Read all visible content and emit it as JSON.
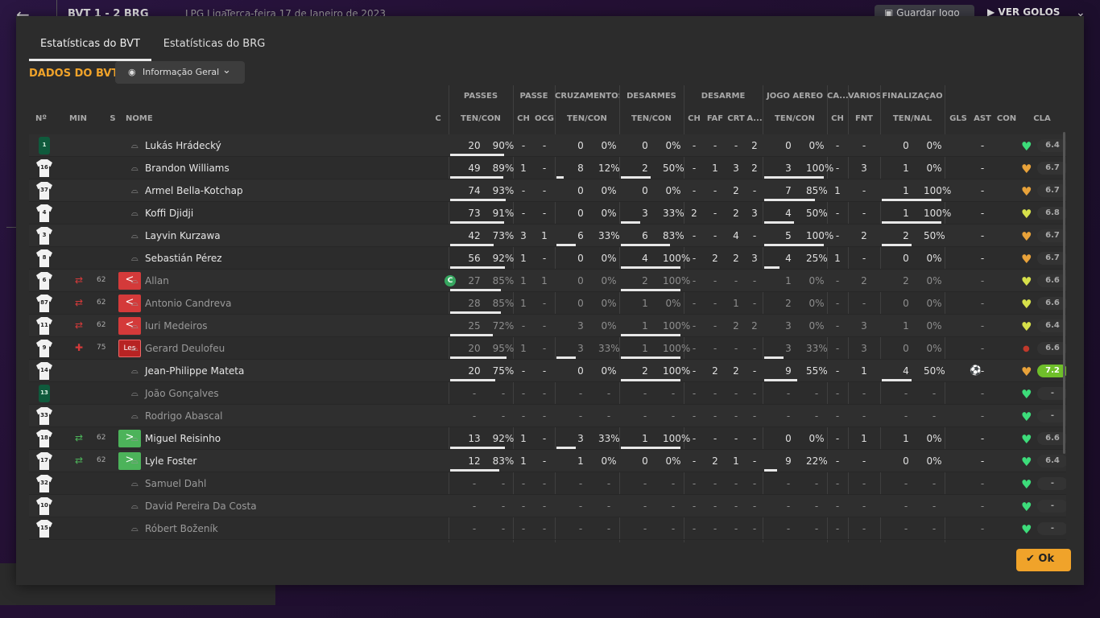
{
  "topbar": {
    "back": "←",
    "score": "BVT   1 - 2   BRG",
    "league": "LPG Liga",
    "date": "Terça-feira 17 de Janeiro de 2023",
    "save_label": "Guardar Jogo",
    "goals_label": "VER GOLOS"
  },
  "tabs": [
    "Estatísticas do BVT",
    "Estatísticas do BRG"
  ],
  "section_title": "DADOS DO BVT",
  "dropdown": "Informação Geral",
  "group_headers": [
    "PASSES",
    "PASSE",
    "CRUZAMENTOS",
    "DESARMES",
    "DESARME",
    "JOGO AÉREO",
    "CA...",
    "VÁRIOS",
    "FINALIZAÇÃO"
  ],
  "sub_headers": [
    "Nº",
    "MIN",
    "S",
    "NOME",
    "C",
    "TEN/CON",
    "CH",
    "OCG",
    "TEN/CON",
    "TEN/CON",
    "CH",
    "FAF",
    "CRT",
    "A...",
    "TEN/CON",
    "CH",
    "FNT",
    "TEN/NAL",
    "GLS",
    "AST",
    "CON",
    "CLA"
  ],
  "rows": [
    {
      "no": "1",
      "gk": true,
      "min": "",
      "sub": "",
      "s": "",
      "name": "Lukás Hrádecký",
      "cap": "",
      "dim": false,
      "pt": "20",
      "pp": "90%",
      "pch": "-",
      "pocg": "-",
      "cr": "0",
      "crp": "0%",
      "ds": "0",
      "dsp": "0%",
      "dch": "-",
      "faf": "-",
      "crt": "-",
      "da": "2",
      "ja": "0",
      "jap": "0%",
      "ca": "-",
      "fnt": "-",
      "fi": "0",
      "fip": "0%",
      "gls": "",
      "ast": "-",
      "con": "heart-green",
      "cla": "6.4",
      "best": false,
      "bars": {
        "p": 90,
        "c": 0,
        "d": 0,
        "j": 0,
        "f": 0
      }
    },
    {
      "no": "16",
      "gk": false,
      "min": "",
      "sub": "",
      "s": "",
      "name": "Brandon Williams",
      "cap": "",
      "dim": false,
      "pt": "49",
      "pp": "89%",
      "pch": "1",
      "pocg": "-",
      "cr": "8",
      "crp": "12%",
      "ds": "2",
      "dsp": "50%",
      "dch": "-",
      "faf": "1",
      "crt": "3",
      "da": "2",
      "ja": "3",
      "jap": "100%",
      "ca": "-",
      "fnt": "3",
      "fi": "1",
      "fip": "0%",
      "gls": "",
      "ast": "-",
      "con": "heart-orange",
      "cla": "6.7",
      "best": false,
      "bars": {
        "p": 89,
        "c": 12,
        "d": 50,
        "j": 100,
        "f": 0
      }
    },
    {
      "no": "37",
      "gk": false,
      "min": "",
      "sub": "",
      "s": "",
      "name": "Armel Bella-Kotchap",
      "cap": "",
      "dim": false,
      "pt": "74",
      "pp": "93%",
      "pch": "-",
      "pocg": "-",
      "cr": "0",
      "crp": "0%",
      "ds": "0",
      "dsp": "0%",
      "dch": "-",
      "faf": "-",
      "crt": "2",
      "da": "-",
      "ja": "7",
      "jap": "85%",
      "ca": "1",
      "fnt": "-",
      "fi": "1",
      "fip": "100%",
      "gls": "",
      "ast": "-",
      "con": "heart-orange",
      "cla": "6.7",
      "best": false,
      "bars": {
        "p": 93,
        "c": 0,
        "d": 0,
        "j": 85,
        "f": 100
      }
    },
    {
      "no": "4",
      "gk": false,
      "min": "",
      "sub": "",
      "s": "",
      "name": "Koffi Djidji",
      "cap": "",
      "dim": false,
      "pt": "73",
      "pp": "91%",
      "pch": "-",
      "pocg": "-",
      "cr": "0",
      "crp": "0%",
      "ds": "3",
      "dsp": "33%",
      "dch": "2",
      "faf": "-",
      "crt": "2",
      "da": "3",
      "ja": "4",
      "jap": "50%",
      "ca": "-",
      "fnt": "-",
      "fi": "1",
      "fip": "100%",
      "gls": "",
      "ast": "-",
      "con": "heart-yellow",
      "cla": "6.8",
      "best": false,
      "bars": {
        "p": 91,
        "c": 0,
        "d": 33,
        "j": 50,
        "f": 100
      }
    },
    {
      "no": "3",
      "gk": false,
      "min": "",
      "sub": "",
      "s": "",
      "name": "Layvin Kurzawa",
      "cap": "",
      "dim": false,
      "pt": "42",
      "pp": "73%",
      "pch": "3",
      "pocg": "1",
      "cr": "6",
      "crp": "33%",
      "ds": "6",
      "dsp": "83%",
      "dch": "-",
      "faf": "-",
      "crt": "4",
      "da": "-",
      "ja": "5",
      "jap": "100%",
      "ca": "-",
      "fnt": "2",
      "fi": "2",
      "fip": "50%",
      "gls": "",
      "ast": "-",
      "con": "heart-orange",
      "cla": "6.7",
      "best": false,
      "bars": {
        "p": 73,
        "c": 33,
        "d": 83,
        "j": 100,
        "f": 50
      }
    },
    {
      "no": "8",
      "gk": false,
      "min": "",
      "sub": "",
      "s": "",
      "name": "Sebastián Pérez",
      "cap": "",
      "dim": false,
      "pt": "56",
      "pp": "92%",
      "pch": "1",
      "pocg": "-",
      "cr": "0",
      "crp": "0%",
      "ds": "4",
      "dsp": "100%",
      "dch": "-",
      "faf": "2",
      "crt": "2",
      "da": "3",
      "ja": "4",
      "jap": "25%",
      "ca": "1",
      "fnt": "-",
      "fi": "0",
      "fip": "0%",
      "gls": "",
      "ast": "-",
      "con": "heart-orange",
      "cla": "6.7",
      "best": false,
      "bars": {
        "p": 92,
        "c": 0,
        "d": 100,
        "j": 25,
        "f": 0
      }
    },
    {
      "no": "6",
      "gk": false,
      "min": "62",
      "sub": "red",
      "s": "out",
      "name": "Allan",
      "cap": "C",
      "dim": true,
      "pt": "27",
      "pp": "85%",
      "pch": "1",
      "pocg": "1",
      "cr": "0",
      "crp": "0%",
      "ds": "2",
      "dsp": "100%",
      "dch": "-",
      "faf": "-",
      "crt": "-",
      "da": "-",
      "ja": "1",
      "jap": "0%",
      "ca": "-",
      "fnt": "2",
      "fi": "2",
      "fip": "0%",
      "gls": "",
      "ast": "-",
      "con": "heart-yellow",
      "cla": "6.6",
      "best": false,
      "bars": {
        "p": 85,
        "c": 0,
        "d": 100,
        "j": 0,
        "f": 0
      }
    },
    {
      "no": "87",
      "gk": false,
      "min": "62",
      "sub": "red",
      "s": "out",
      "name": "Antonio Candreva",
      "cap": "",
      "dim": true,
      "pt": "28",
      "pp": "85%",
      "pch": "1",
      "pocg": "-",
      "cr": "0",
      "crp": "0%",
      "ds": "1",
      "dsp": "0%",
      "dch": "-",
      "faf": "-",
      "crt": "1",
      "da": "-",
      "ja": "2",
      "jap": "0%",
      "ca": "-",
      "fnt": "-",
      "fi": "0",
      "fip": "0%",
      "gls": "",
      "ast": "-",
      "con": "heart-yellow",
      "cla": "6.6",
      "best": false,
      "bars": {
        "p": 85,
        "c": 0,
        "d": 0,
        "j": 0,
        "f": 0
      }
    },
    {
      "no": "11",
      "gk": false,
      "min": "62",
      "sub": "red",
      "s": "out",
      "name": "Iuri Medeiros",
      "cap": "",
      "dim": true,
      "pt": "25",
      "pp": "72%",
      "pch": "-",
      "pocg": "-",
      "cr": "3",
      "crp": "0%",
      "ds": "1",
      "dsp": "100%",
      "dch": "-",
      "faf": "-",
      "crt": "2",
      "da": "2",
      "ja": "3",
      "jap": "0%",
      "ca": "-",
      "fnt": "3",
      "fi": "1",
      "fip": "0%",
      "gls": "",
      "ast": "-",
      "con": "heart-yellow",
      "cla": "6.4",
      "best": false,
      "bars": {
        "p": 72,
        "c": 0,
        "d": 100,
        "j": 0,
        "f": 0
      }
    },
    {
      "no": "9",
      "gk": false,
      "min": "75",
      "sub": "injury",
      "s": "les",
      "name": "Gerard Deulofeu",
      "cap": "",
      "dim": true,
      "pt": "20",
      "pp": "95%",
      "pch": "1",
      "pocg": "-",
      "cr": "3",
      "crp": "33%",
      "ds": "1",
      "dsp": "100%",
      "dch": "-",
      "faf": "-",
      "crt": "-",
      "da": "-",
      "ja": "3",
      "jap": "33%",
      "ca": "-",
      "fnt": "3",
      "fi": "0",
      "fip": "0%",
      "gls": "",
      "ast": "-",
      "con": "dot-red",
      "cla": "6.6",
      "best": false,
      "bars": {
        "p": 95,
        "c": 33,
        "d": 100,
        "j": 33,
        "f": 0
      }
    },
    {
      "no": "14",
      "gk": false,
      "min": "",
      "sub": "",
      "s": "",
      "name": "Jean-Philippe Mateta",
      "cap": "",
      "dim": false,
      "pt": "20",
      "pp": "75%",
      "pch": "-",
      "pocg": "-",
      "cr": "0",
      "crp": "0%",
      "ds": "2",
      "dsp": "100%",
      "dch": "-",
      "faf": "2",
      "crt": "2",
      "da": "-",
      "ja": "9",
      "jap": "55%",
      "ca": "-",
      "fnt": "1",
      "fi": "4",
      "fip": "50%",
      "gls": "ball",
      "ast": "-",
      "con": "heart-orange",
      "cla": "7.2",
      "best": true,
      "bars": {
        "p": 75,
        "c": 0,
        "d": 100,
        "j": 55,
        "f": 50
      }
    },
    {
      "no": "13",
      "gk": true,
      "min": "",
      "sub": "",
      "s": "",
      "name": "João Gonçalves",
      "cap": "",
      "dim": true,
      "pt": "-",
      "pp": "-",
      "pch": "-",
      "pocg": "-",
      "cr": "-",
      "crp": "-",
      "ds": "-",
      "dsp": "-",
      "dch": "-",
      "faf": "-",
      "crt": "-",
      "da": "-",
      "ja": "-",
      "jap": "-",
      "ca": "-",
      "fnt": "-",
      "fi": "-",
      "fip": "-",
      "gls": "",
      "ast": "-",
      "con": "heart-green",
      "cla": "-",
      "best": false,
      "bars": {
        "p": 0,
        "c": 0,
        "d": 0,
        "j": 0,
        "f": 0
      }
    },
    {
      "no": "33",
      "gk": false,
      "min": "",
      "sub": "",
      "s": "",
      "name": "Rodrigo Abascal",
      "cap": "",
      "dim": true,
      "pt": "-",
      "pp": "-",
      "pch": "-",
      "pocg": "-",
      "cr": "-",
      "crp": "-",
      "ds": "-",
      "dsp": "-",
      "dch": "-",
      "faf": "-",
      "crt": "-",
      "da": "-",
      "ja": "-",
      "jap": "-",
      "ca": "-",
      "fnt": "-",
      "fi": "-",
      "fip": "-",
      "gls": "",
      "ast": "-",
      "con": "heart-green",
      "cla": "-",
      "best": false,
      "bars": {
        "p": 0,
        "c": 0,
        "d": 0,
        "j": 0,
        "f": 0
      }
    },
    {
      "no": "18",
      "gk": false,
      "min": "62",
      "sub": "green",
      "s": "in",
      "name": "Miguel Reisinho",
      "cap": "",
      "dim": false,
      "pt": "13",
      "pp": "92%",
      "pch": "1",
      "pocg": "-",
      "cr": "3",
      "crp": "33%",
      "ds": "1",
      "dsp": "100%",
      "dch": "-",
      "faf": "-",
      "crt": "-",
      "da": "-",
      "ja": "0",
      "jap": "0%",
      "ca": "-",
      "fnt": "1",
      "fi": "1",
      "fip": "0%",
      "gls": "",
      "ast": "-",
      "con": "heart-green",
      "cla": "6.6",
      "best": false,
      "bars": {
        "p": 92,
        "c": 33,
        "d": 100,
        "j": 0,
        "f": 0
      }
    },
    {
      "no": "17",
      "gk": false,
      "min": "62",
      "sub": "green",
      "s": "in",
      "name": "Lyle Foster",
      "cap": "",
      "dim": false,
      "pt": "12",
      "pp": "83%",
      "pch": "1",
      "pocg": "-",
      "cr": "1",
      "crp": "0%",
      "ds": "0",
      "dsp": "0%",
      "dch": "-",
      "faf": "2",
      "crt": "1",
      "da": "-",
      "ja": "9",
      "jap": "22%",
      "ca": "-",
      "fnt": "-",
      "fi": "0",
      "fip": "0%",
      "gls": "",
      "ast": "-",
      "con": "heart-green",
      "cla": "6.4",
      "best": false,
      "bars": {
        "p": 83,
        "c": 0,
        "d": 0,
        "j": 22,
        "f": 0
      }
    },
    {
      "no": "32",
      "gk": false,
      "min": "",
      "sub": "",
      "s": "",
      "name": "Samuel Dahl",
      "cap": "",
      "dim": true,
      "pt": "-",
      "pp": "-",
      "pch": "-",
      "pocg": "-",
      "cr": "-",
      "crp": "-",
      "ds": "-",
      "dsp": "-",
      "dch": "-",
      "faf": "-",
      "crt": "-",
      "da": "-",
      "ja": "-",
      "jap": "-",
      "ca": "-",
      "fnt": "-",
      "fi": "-",
      "fip": "-",
      "gls": "",
      "ast": "-",
      "con": "heart-green",
      "cla": "-",
      "best": false,
      "bars": {
        "p": 0,
        "c": 0,
        "d": 0,
        "j": 0,
        "f": 0
      }
    },
    {
      "no": "10",
      "gk": false,
      "min": "",
      "sub": "",
      "s": "",
      "name": "David Pereira Da Costa",
      "cap": "",
      "dim": true,
      "pt": "-",
      "pp": "-",
      "pch": "-",
      "pocg": "-",
      "cr": "-",
      "crp": "-",
      "ds": "-",
      "dsp": "-",
      "dch": "-",
      "faf": "-",
      "crt": "-",
      "da": "-",
      "ja": "-",
      "jap": "-",
      "ca": "-",
      "fnt": "-",
      "fi": "-",
      "fip": "-",
      "gls": "",
      "ast": "-",
      "con": "heart-green",
      "cla": "-",
      "best": false,
      "bars": {
        "p": 0,
        "c": 0,
        "d": 0,
        "j": 0,
        "f": 0
      }
    },
    {
      "no": "15",
      "gk": false,
      "min": "",
      "sub": "",
      "s": "",
      "name": "Róbert Boženík",
      "cap": "",
      "dim": true,
      "pt": "-",
      "pp": "-",
      "pch": "-",
      "pocg": "-",
      "cr": "-",
      "crp": "-",
      "ds": "-",
      "dsp": "-",
      "dch": "-",
      "faf": "-",
      "crt": "-",
      "da": "-",
      "ja": "-",
      "jap": "-",
      "ca": "-",
      "fnt": "-",
      "fi": "-",
      "fip": "-",
      "gls": "",
      "ast": "-",
      "con": "heart-green",
      "cla": "-",
      "best": false,
      "bars": {
        "p": 0,
        "c": 0,
        "d": 0,
        "j": 0,
        "f": 0
      }
    }
  ],
  "ok_label": "Ok",
  "colors": {
    "accent": "#f0a32a",
    "modal_bg": "#2c2c2c",
    "sub_out": "#d43a3a",
    "sub_in": "#4cb35a",
    "heart_green": "#3ddc7a",
    "heart_yellow": "#d6e04a",
    "heart_orange": "#e8a23a",
    "best_rating": "#6fbf2a"
  }
}
